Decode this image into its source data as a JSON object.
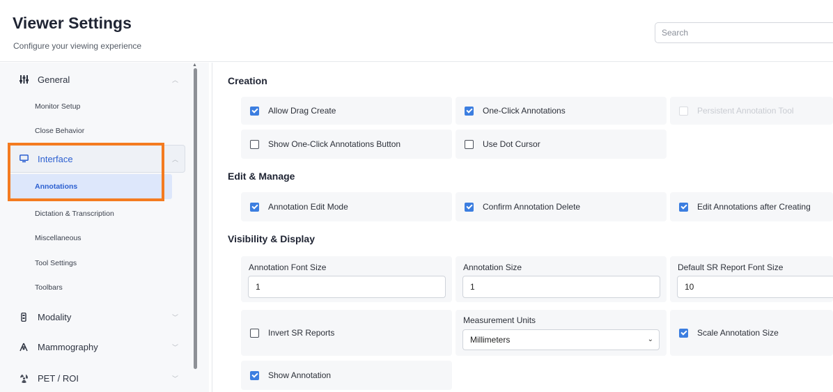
{
  "header": {
    "title": "Viewer Settings",
    "subtitle": "Configure your viewing experience",
    "search_placeholder": "Search"
  },
  "sidebar": {
    "general": {
      "label": "General",
      "icon": "sliders-icon",
      "children": [
        "Monitor Setup",
        "Close Behavior"
      ]
    },
    "interface": {
      "label": "Interface",
      "icon": "monitor-icon",
      "children": [
        "Annotations",
        "Dictation & Transcription",
        "Miscellaneous",
        "Tool Settings",
        "Toolbars"
      ],
      "active": "Annotations"
    },
    "modality": {
      "label": "Modality",
      "icon": "device-icon"
    },
    "mammography": {
      "label": "Mammography",
      "icon": "mammography-icon"
    },
    "pet_roi": {
      "label": "PET / ROI",
      "icon": "radiation-icon"
    },
    "highlight_color": "#f47b20"
  },
  "sections": {
    "creation": {
      "title": "Creation",
      "options": [
        {
          "label": "Allow Drag Create",
          "checked": true
        },
        {
          "label": "One-Click Annotations",
          "checked": true
        },
        {
          "label": "Persistent Annotation Tool",
          "checked": false,
          "disabled": true
        },
        {
          "label": "Show One-Click Annotations Button",
          "checked": false
        },
        {
          "label": "Use Dot Cursor",
          "checked": false
        }
      ]
    },
    "edit": {
      "title": "Edit & Manage",
      "options": [
        {
          "label": "Annotation Edit Mode",
          "checked": true
        },
        {
          "label": "Confirm Annotation Delete",
          "checked": true
        },
        {
          "label": "Edit Annotations after Creating",
          "checked": true
        }
      ]
    },
    "visibility": {
      "title": "Visibility & Display",
      "fields": [
        {
          "label": "Annotation Font Size",
          "value": "1"
        },
        {
          "label": "Annotation Size",
          "value": "1"
        },
        {
          "label": "Default SR Report Font Size",
          "value": "10"
        }
      ],
      "invert_sr": {
        "label": "Invert SR Reports",
        "checked": false
      },
      "units": {
        "label": "Measurement Units",
        "value": "Millimeters"
      },
      "scale": {
        "label": "Scale Annotation Size",
        "checked": true
      },
      "show": {
        "label": "Show Annotation",
        "checked": true
      }
    }
  },
  "colors": {
    "accent": "#3c7ee0",
    "highlight": "#f47b20"
  }
}
